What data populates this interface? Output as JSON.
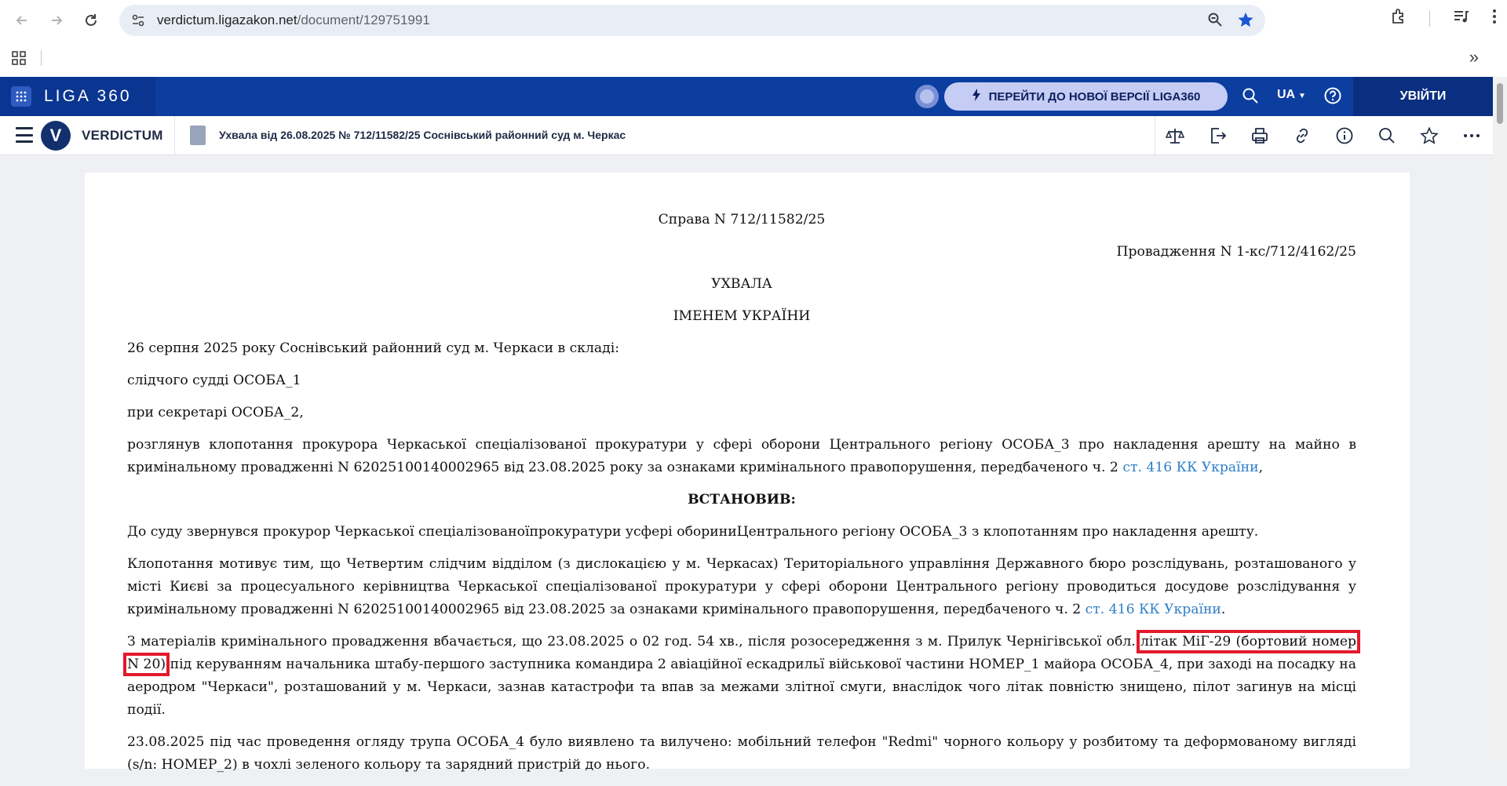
{
  "browser": {
    "url_host": "verdictum.ligazakon.net",
    "url_path": "/document/129751991"
  },
  "liga": {
    "logo": "LIGA 360",
    "new_version": "ПЕРЕЙТИ ДО НОВОЇ ВЕРСІЇ LIGA360",
    "lang": "UA",
    "login": "УВІЙТИ"
  },
  "verdictum": {
    "name": "VERDICTUM",
    "logo_letter": "V",
    "doc_title": "Ухвала від 26.08.2025 № 712/11582/25 Соснівський районний суд м. Черкас"
  },
  "document": {
    "case_no": "Справа N 712/11582/25",
    "proceeding_no": "Провадження N 1-кс/712/4162/25",
    "type": "УХВАЛА",
    "in_name": "ІМЕНЕМ УКРАЇНИ",
    "p1": "26 серпня 2025 року Соснівський районний суд м. Черкаси в складі:",
    "p2": "слідчого судді ОСОБА_1",
    "p3": "при секретарі ОСОБА_2,",
    "p4_text": "розглянув клопотання прокурора Черкаської спеціалізованої прокуратури у сфері оборони Центрального регіону ОСОБА_3 про накладення арешту на майно в кримінальному провадженні N 62025100140002965 від 23.08.2025 року за ознаками кримінального правопорушення, передбаченого ч. 2 ",
    "p4_link": "ст. 416 КК України",
    "p4_end": ",",
    "established": "ВСТАНОВИВ:",
    "p5": "До суду звернувся прокурор Черкаської спеціалізованоїпрокуратури усфері обориниЦентрального регіону ОСОБА_3 з клопотанням про накладення арешту.",
    "p6_text": "Клопотання мотивує тим, що Четвертим слідчим відділом (з дислокацією у м. Черкасах) Територіального управління Державного бюро розслідувань, розташованого у місті Києві за процесуального керівництва Черкаської спеціалізованої прокуратури у сфері оборони Центрального регіону проводиться досудове розслідування у кримінальному провадженні N 62025100140002965 від 23.08.2025 за ознаками кримінального правопорушення, передбаченого ч. 2 ",
    "p6_link": "ст. 416 КК України",
    "p6_end": ".",
    "p7_start": "З матеріалів кримінального провадження вбачається, що 23.08.2025 о 02 год. 54 хв., після розосередження з м. Прилук Чернігівської обл. ",
    "p7_highlight": "літак МіГ-29 (бортовий номер N 20)",
    "p7_end": " під керуванням начальника штабу-першого заступника командира 2 авіаційної ескадрильї військової частини НОМЕР_1 майора ОСОБА_4, при заході на посадку на аеродром \"Черкаси\", розташований у м. Черкаси, зазнав катастрофи та впав за межами злітної смуги, внаслідок чого літак повністю знищено, пілот загинув на місці події.",
    "p8": "23.08.2025 під час проведення огляду трупа ОСОБА_4 було виявлено та вилучено: мобільний телефон \"Redmi\" чорного кольору у розбитому та деформованому вигляді (s/n: НОМЕР_2) в чохлі зеленого кольору та зарядний пристрій до нього."
  }
}
